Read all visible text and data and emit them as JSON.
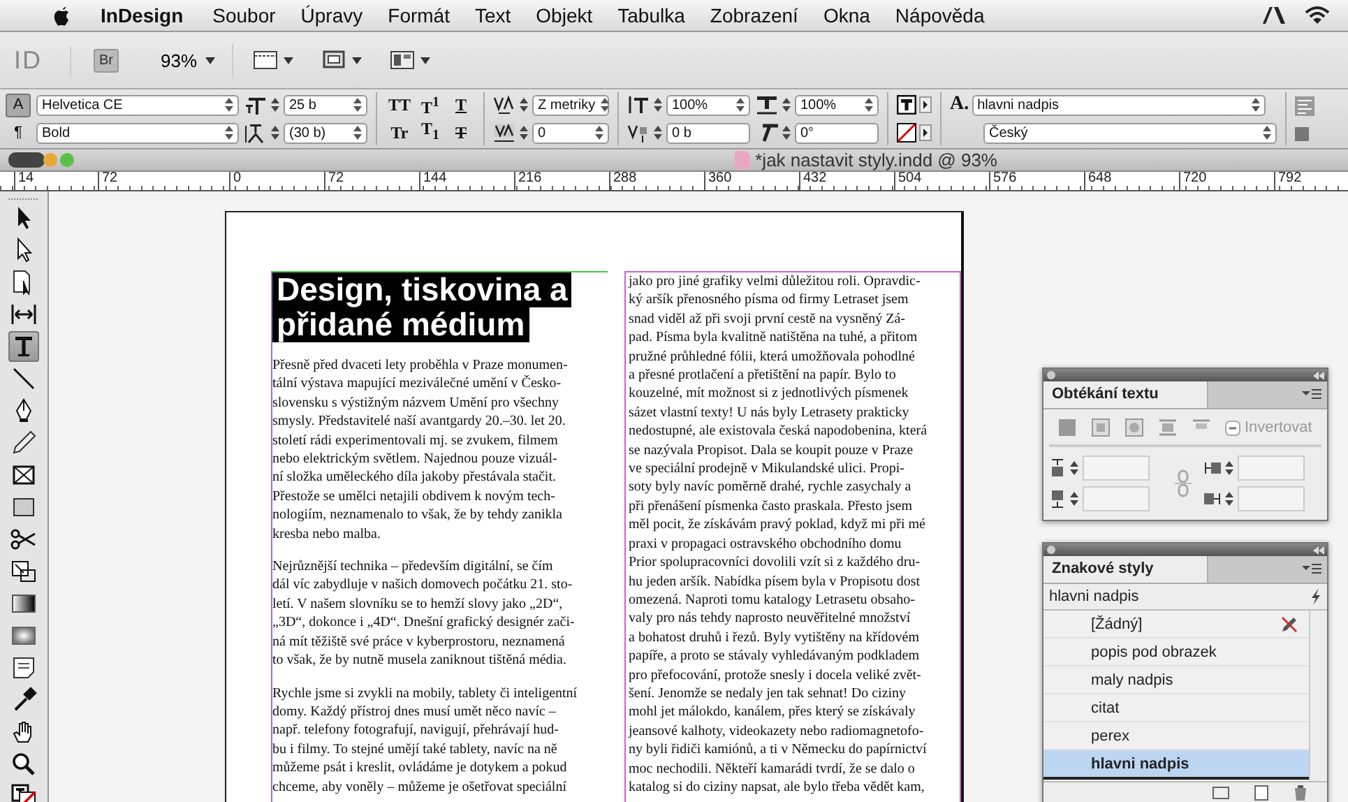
{
  "menu_bar": {
    "app_name": "InDesign",
    "items": [
      "Soubor",
      "Úpravy",
      "Formát",
      "Text",
      "Objekt",
      "Tabulka",
      "Zobrazení",
      "Okna",
      "Nápověda"
    ]
  },
  "app_bar": {
    "logo": "ID",
    "bridge": "Br",
    "zoom": "93%"
  },
  "control_panel": {
    "mode_buttons": [
      {
        "label": "A",
        "selected": true
      },
      {
        "label": "¶",
        "selected": false
      }
    ],
    "font_family": "Helvetica CE",
    "font_style": "Bold",
    "size_fields": [
      {
        "kind": "font-size",
        "value": "25 b",
        "dropdown": true
      },
      {
        "kind": "leading",
        "value": "(30 b)",
        "dropdown": true
      }
    ],
    "type_buttons": [
      {
        "label": "TT",
        "kind": "plain"
      },
      {
        "label": "T$^{1}$",
        "kind": "plain"
      },
      {
        "label": "T",
        "kind": "underline"
      },
      {
        "label": "Tr",
        "kind": "plain"
      },
      {
        "label": "T$_{1}$",
        "kind": "plain"
      },
      {
        "label": "T",
        "kind": "strike"
      }
    ],
    "spacing_fields": [
      {
        "kind": "kerning",
        "value": "Z metriky",
        "dropdown": true
      },
      {
        "kind": "tracking",
        "value": "0",
        "dropdown": true
      }
    ],
    "scale_fields": [
      {
        "kind": "vertical-scale",
        "value": "100%",
        "dropdown": true
      },
      {
        "kind": "baseline-shift",
        "value": "0 b",
        "dropdown": false
      }
    ],
    "scale_fields_2": [
      {
        "kind": "horizontal-scale",
        "value": "100%",
        "dropdown": true
      },
      {
        "kind": "skew",
        "value": "0°",
        "dropdown": false
      }
    ],
    "style_glyph": "A.",
    "character_style": "hlavni nadpis",
    "language": "Český"
  },
  "document": {
    "title": "*jak nastavit styly.indd @ 93%"
  },
  "ruler_labels": [
    "14",
    "72",
    "0",
    "72",
    "144",
    "216",
    "288",
    "360",
    "432",
    "504",
    "576",
    "648",
    "720",
    "792"
  ],
  "tools": [
    {
      "kind": "selection",
      "selected": false
    },
    {
      "kind": "direct-selection",
      "selected": false
    },
    {
      "kind": "page",
      "selected": false
    },
    {
      "kind": "gap",
      "selected": false
    },
    {
      "kind": "type",
      "selected": true
    },
    {
      "kind": "line",
      "selected": false
    },
    {
      "kind": "pen",
      "selected": false
    },
    {
      "kind": "pencil",
      "selected": false
    },
    {
      "kind": "frame",
      "selected": false
    },
    {
      "kind": "rectangle",
      "selected": false
    },
    {
      "kind": "scissors",
      "selected": false
    },
    {
      "kind": "transform",
      "selected": false
    },
    {
      "kind": "gradient",
      "selected": false
    },
    {
      "kind": "feather",
      "selected": false
    },
    {
      "kind": "note",
      "selected": false
    },
    {
      "kind": "eyedropper",
      "selected": false
    },
    {
      "kind": "hand",
      "selected": false
    },
    {
      "kind": "zoom",
      "selected": false
    },
    {
      "kind": "fill-stroke",
      "selected": false
    }
  ],
  "page": {
    "heading": [
      "Design, tiskovina a",
      "přidané médium"
    ],
    "column_1": [
      [
        "Přesně před dvaceti lety proběhla v Praze monumen-",
        "tální výstava mapující meziválečné umění v Česko-",
        "slovensku s výstižným názvem Umění pro všechny",
        "smysly. Představitelé naší avantgardy 20.–30. let 20.",
        "století rádi experimentovali mj. se zvukem, filmem",
        "nebo elektrickým světlem. Najednou pouze vizuál-",
        "ní složka uměleckého díla jakoby přestávala stačit.",
        "Přestože se umělci netajili obdivem k novým tech-",
        "nologiím, neznamenalo to však, že by tehdy zanikla",
        "kresba nebo malba."
      ],
      [
        "Nejrůznější technika – především digitální, se čím",
        "dál víc zabydluje v našich domovech počátku 21. sto-",
        "letí. V našem slovníku se to hemží slovy jako „2D“,",
        "„3D“, dokonce i „4D“. Dnešní grafický designér zači-",
        "ná mít těžiště své práce v kyberprostoru, neznamená",
        "to však, že by nutně musela zaniknout tištěná média."
      ],
      [
        "Rychle jsme si zvykli na mobily, tablety či inteligentní",
        "domy. Každý přístroj dnes musí umět něco navíc –",
        "např. telefony fotografují, navigují, přehrávají hud-",
        "bu i filmy. To stejné umějí také tablety, navíc na ně",
        "můžeme psát i kreslit, ovládáme je dotykem a pokud",
        "chceme, aby voněly – můžeme je ošetřovat speciální"
      ]
    ],
    "column_2": [
      [
        "jako pro jiné grafiky velmi důležitou roli. Opravdic-",
        "ký aršík přenosného písma od firmy Letraset jsem",
        "snad viděl až při svoji první cestě na vysněný Zá-",
        "pad. Písma byla kvalitně natištěna na tuhé, a přitom",
        "pružné průhledné fólii, která umožňovala pohodlné",
        "a přesné protlačení a přetištění na papír. Bylo to",
        "kouzelné, mít možnost si z jednotlivých písmenek",
        "sázet vlastní texty! U nás byly Letrasety prakticky",
        "nedostupné, ale existovala česká napodobenina, která",
        "se nazývala Propisot. Dala se koupit pouze v Praze",
        "ve speciální prodejně v Mikulandské ulici. Propi-",
        "soty byly navíc poměrně drahé, rychle zasychaly a",
        "při přenášení písmenka často praskala. Přesto jsem",
        "měl pocit, že získávám pravý poklad, když mi při mé",
        "praxi v propagaci ostravského obchodního domu",
        "Prior spolupracovníci dovolili vzít si z každého dru-",
        "hu jeden aršík. Nabídka písem byla v Propisotu dost",
        "omezená. Naproti tomu katalogy Letrasetu obsaho-",
        "valy pro nás tehdy naprosto neuvěřitelné množství",
        "a bohatost druhů i řezů. Byly vytištěny na křídovém",
        "papíře, a proto se stávaly vyhledávaným podkladem",
        "pro přefocování, protože snesly i docela veliké zvět-",
        "šení. Jenomže se nedaly jen tak sehnat! Do ciziny",
        "mohl jet málokdo, kanálem, přes který se získávaly",
        "jeansové kalhoty, videokazety nebo radiomagnetofo-",
        "ny byli řidiči kamiónů, a ti v Německu do papírnictví",
        "moc nechodili. Někteří kamarádi tvrdí, že se dalo o",
        "katalog si do ciziny napsat, ale bylo třeba vědět kam,"
      ]
    ]
  },
  "wrap_panel": {
    "title": "Obtékání textu",
    "invert": {
      "label": "Invertovat",
      "disabled": true
    }
  },
  "styles_panel": {
    "title": "Znakové styly",
    "current": "hlavni nadpis",
    "items": [
      {
        "name": "[Žádný]",
        "selected": false,
        "locked": true
      },
      {
        "name": "popis pod obrazek",
        "selected": false,
        "locked": false
      },
      {
        "name": "maly nadpis",
        "selected": false,
        "locked": false
      },
      {
        "name": "citat",
        "selected": false,
        "locked": false
      },
      {
        "name": "perex",
        "selected": false,
        "locked": false
      },
      {
        "name": "hlavni nadpis",
        "selected": true,
        "locked": false
      }
    ]
  }
}
